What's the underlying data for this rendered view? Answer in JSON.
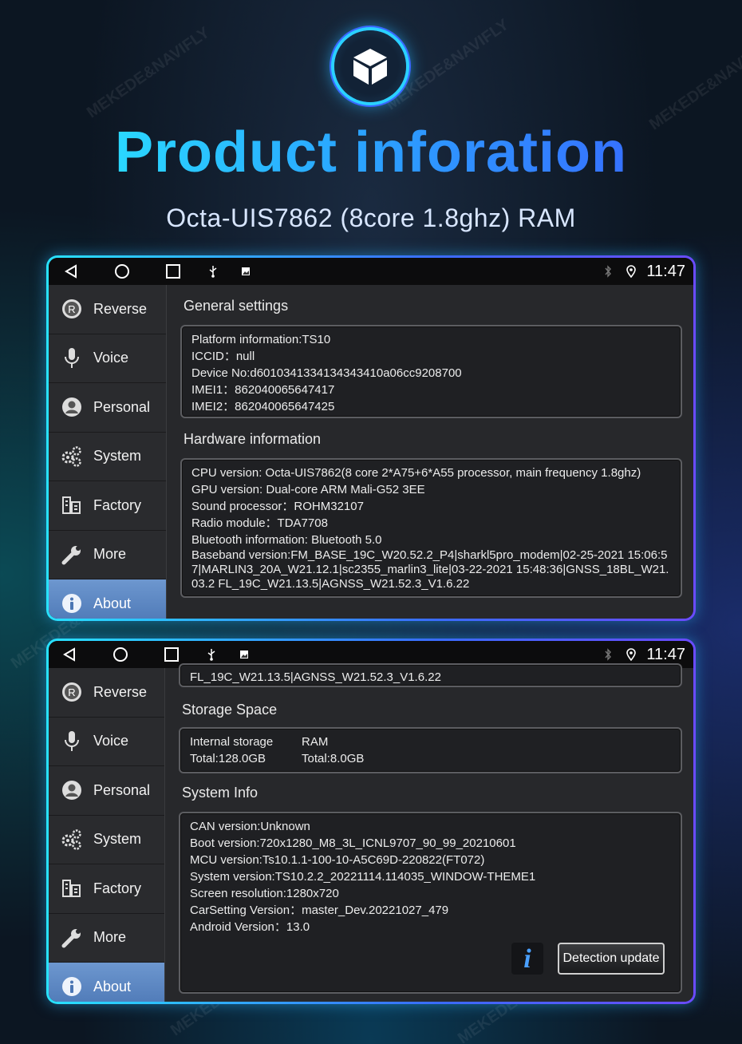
{
  "header": {
    "icon": "cube-icon",
    "title": "Product inforation",
    "subtitle": "Octa-UIS7862 (8core 1.8ghz) RAM"
  },
  "watermark": "MEKEDE&NAVIFLY",
  "statusbar": {
    "time": "11:47",
    "icons": [
      "back-icon",
      "home-icon",
      "recents-icon",
      "usb-icon",
      "image-icon",
      "bluetooth-icon",
      "location-icon"
    ]
  },
  "sidebar": {
    "items": [
      {
        "label": "Reverse",
        "icon": "reverse-icon"
      },
      {
        "label": "Voice",
        "icon": "microphone-icon"
      },
      {
        "label": "Personal",
        "icon": "person-icon"
      },
      {
        "label": "System",
        "icon": "gears-icon"
      },
      {
        "label": "Factory",
        "icon": "factory-icon"
      },
      {
        "label": "More",
        "icon": "wrench-icon"
      },
      {
        "label": "About",
        "icon": "info-icon",
        "active": true
      }
    ]
  },
  "screen1": {
    "general_title": "General settings",
    "general_lines": [
      "Platform information:TS10",
      "ICCID：null",
      "Device No:d6010341334134343410a06cc9208700",
      "IMEI1：862040065647417",
      "IMEI2：862040065647425"
    ],
    "hardware_title": "Hardware information",
    "hardware_lines": [
      "CPU version: Octa-UIS7862(8 core 2*A75+6*A55 processor, main frequency 1.8ghz)",
      "GPU version: Dual-core ARM Mali-G52 3EE",
      "Sound processor：ROHM32107",
      "Radio module：TDA7708",
      "Bluetooth information: Bluetooth 5.0"
    ],
    "baseband": "Baseband version:FM_BASE_19C_W20.52.2_P4|sharkl5pro_modem|02-25-2021 15:06:57|MARLIN3_20A_W21.12.1|sc2355_marlin3_lite|03-22-2021 15:48:36|GNSS_18BL_W21.03.2 FL_19C_W21.13.5|AGNSS_W21.52.3_V1.6.22"
  },
  "screen2": {
    "top_remnant": "FL_19C_W21.13.5|AGNSS_W21.52.3_V1.6.22",
    "storage_title": "Storage Space",
    "storage": {
      "internal_label": "Internal storage",
      "internal_total": "Total:128.0GB",
      "ram_label": "RAM",
      "ram_total": "Total:8.0GB"
    },
    "sysinfo_title": "System Info",
    "sysinfo_lines": [
      "CAN version:Unknown",
      "Boot version:720x1280_M8_3L_ICNL9707_90_99_20210601",
      "MCU version:Ts10.1.1-100-10-A5C69D-220822(FT072)",
      "System version:TS10.2.2_20221114.114035_WINDOW-THEME1",
      "Screen resolution:1280x720",
      "CarSetting Version：master_Dev.20221027_479",
      "Android Version：13.0"
    ],
    "detect_button": "Detection update",
    "info_glyph": "i"
  }
}
